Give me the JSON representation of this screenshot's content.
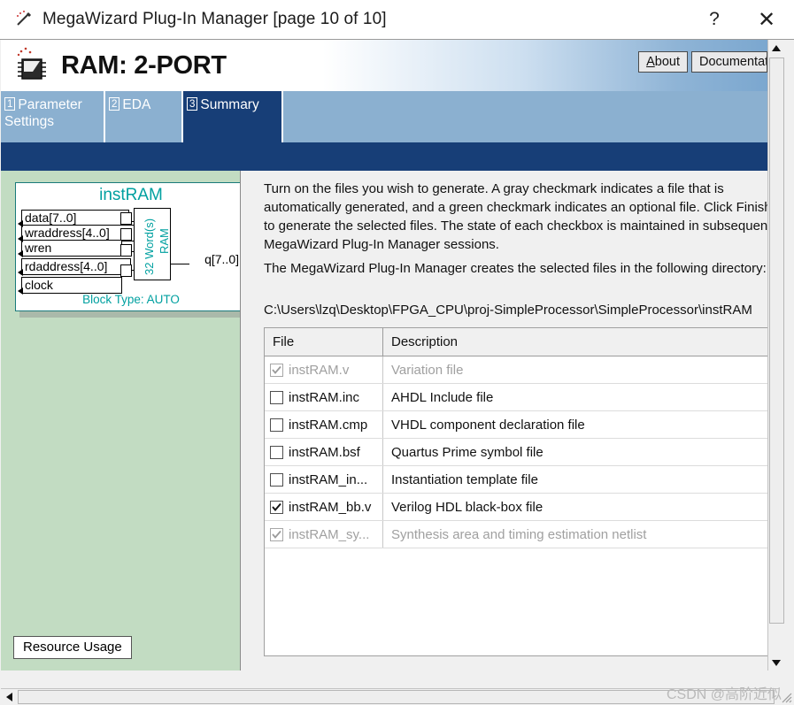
{
  "window": {
    "title": "MegaWizard Plug-In Manager [page 10 of 10]",
    "icon": "wizard-wand-icon",
    "help_label": "?",
    "close_label": "✕"
  },
  "banner": {
    "title": "RAM: 2-PORT",
    "icon": "chip-icon",
    "about_label_accel": "A",
    "about_label_rest": "bout",
    "documentation_label": "Documentation"
  },
  "tabs": [
    {
      "num": "1",
      "label": "Parameter\nSettings",
      "active": false
    },
    {
      "num": "2",
      "label": "EDA",
      "active": false
    },
    {
      "num": "3",
      "label": "Summary",
      "active": true
    }
  ],
  "symbol": {
    "name": "instRAM",
    "footer": "Block Type: AUTO",
    "ram_line1": "32 Word(s)",
    "ram_line2": "RAM",
    "inputs": [
      "data[7..0]",
      "wraddress[4..0]",
      "wren",
      "rdaddress[4..0]",
      "clock"
    ],
    "outputs": [
      "q[7..0]"
    ]
  },
  "left_panel": {
    "resource_usage_label": "Resource Usage"
  },
  "instructions": {
    "paragraph1": "Turn on the files you wish to generate. A gray checkmark indicates a file that is automatically generated, and a green checkmark indicates an optional file. Click Finish to generate the selected files. The state of each checkbox is maintained in subsequent MegaWizard Plug-In Manager sessions.",
    "paragraph2": "The MegaWizard Plug-In Manager creates the selected files in the following directory:",
    "directory": "C:\\Users\\lzq\\Desktop\\FPGA_CPU\\proj-SimpleProcessor\\SimpleProcessor\\instRAM"
  },
  "file_table": {
    "headers": [
      "File",
      "Description"
    ],
    "rows": [
      {
        "checked": true,
        "disabled": true,
        "file": "instRAM.v",
        "description": "Variation file"
      },
      {
        "checked": false,
        "disabled": false,
        "file": "instRAM.inc",
        "description": "AHDL Include file"
      },
      {
        "checked": false,
        "disabled": false,
        "file": "instRAM.cmp",
        "description": "VHDL component declaration file"
      },
      {
        "checked": false,
        "disabled": false,
        "file": "instRAM.bsf",
        "description": "Quartus Prime symbol file"
      },
      {
        "checked": false,
        "disabled": false,
        "file": "instRAM_in...",
        "description": "Instantiation template file"
      },
      {
        "checked": true,
        "disabled": false,
        "file": "instRAM_bb.v",
        "description": "Verilog HDL black-box file"
      },
      {
        "checked": true,
        "disabled": true,
        "file": "instRAM_sy...",
        "description": "Synthesis area and timing estimation netlist"
      }
    ]
  },
  "watermark": {
    "text": "CSDN @高阶近似"
  },
  "colors": {
    "navy": "#173e77",
    "tab_blue": "#8bb0d0",
    "panel_green": "#c2dcc2",
    "symbol_teal": "#00a0a0",
    "chrome_gray": "#f0f0f0"
  }
}
